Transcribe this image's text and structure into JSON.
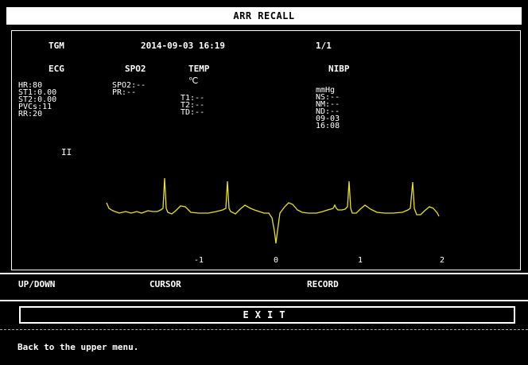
{
  "window": {
    "title": "ARR RECALL"
  },
  "header": {
    "event": "TGM",
    "datetime": "2014-09-03 16:19",
    "page": "1/1"
  },
  "sections": {
    "ecg": {
      "title": "ECG",
      "lines": [
        "HR:80",
        "ST1:0.00",
        "ST2:0.00",
        "PVCs:11",
        "RR:20"
      ],
      "lead": "II"
    },
    "spo2": {
      "title": "SPO2",
      "lines": [
        "SPO2:--",
        "PR:--"
      ]
    },
    "temp": {
      "title": "TEMP",
      "unit": "℃",
      "lines": [
        "T1:--",
        "T2:--",
        "TD:--"
      ]
    },
    "nibp": {
      "title": "NIBP",
      "lines": [
        "mmHg",
        "NS:--",
        "NM:--",
        "ND:--",
        "09-03",
        "16:08"
      ]
    }
  },
  "waveform": {
    "color": "#e8e21f",
    "time_labels": [
      "-1",
      "0",
      "1",
      "2"
    ]
  },
  "bottom_bar": {
    "updown": "UP/DOWN",
    "cursor": "CURSOR",
    "record": "RECORD"
  },
  "exit_label": "EXIT",
  "status_message": "Back to the upper menu."
}
